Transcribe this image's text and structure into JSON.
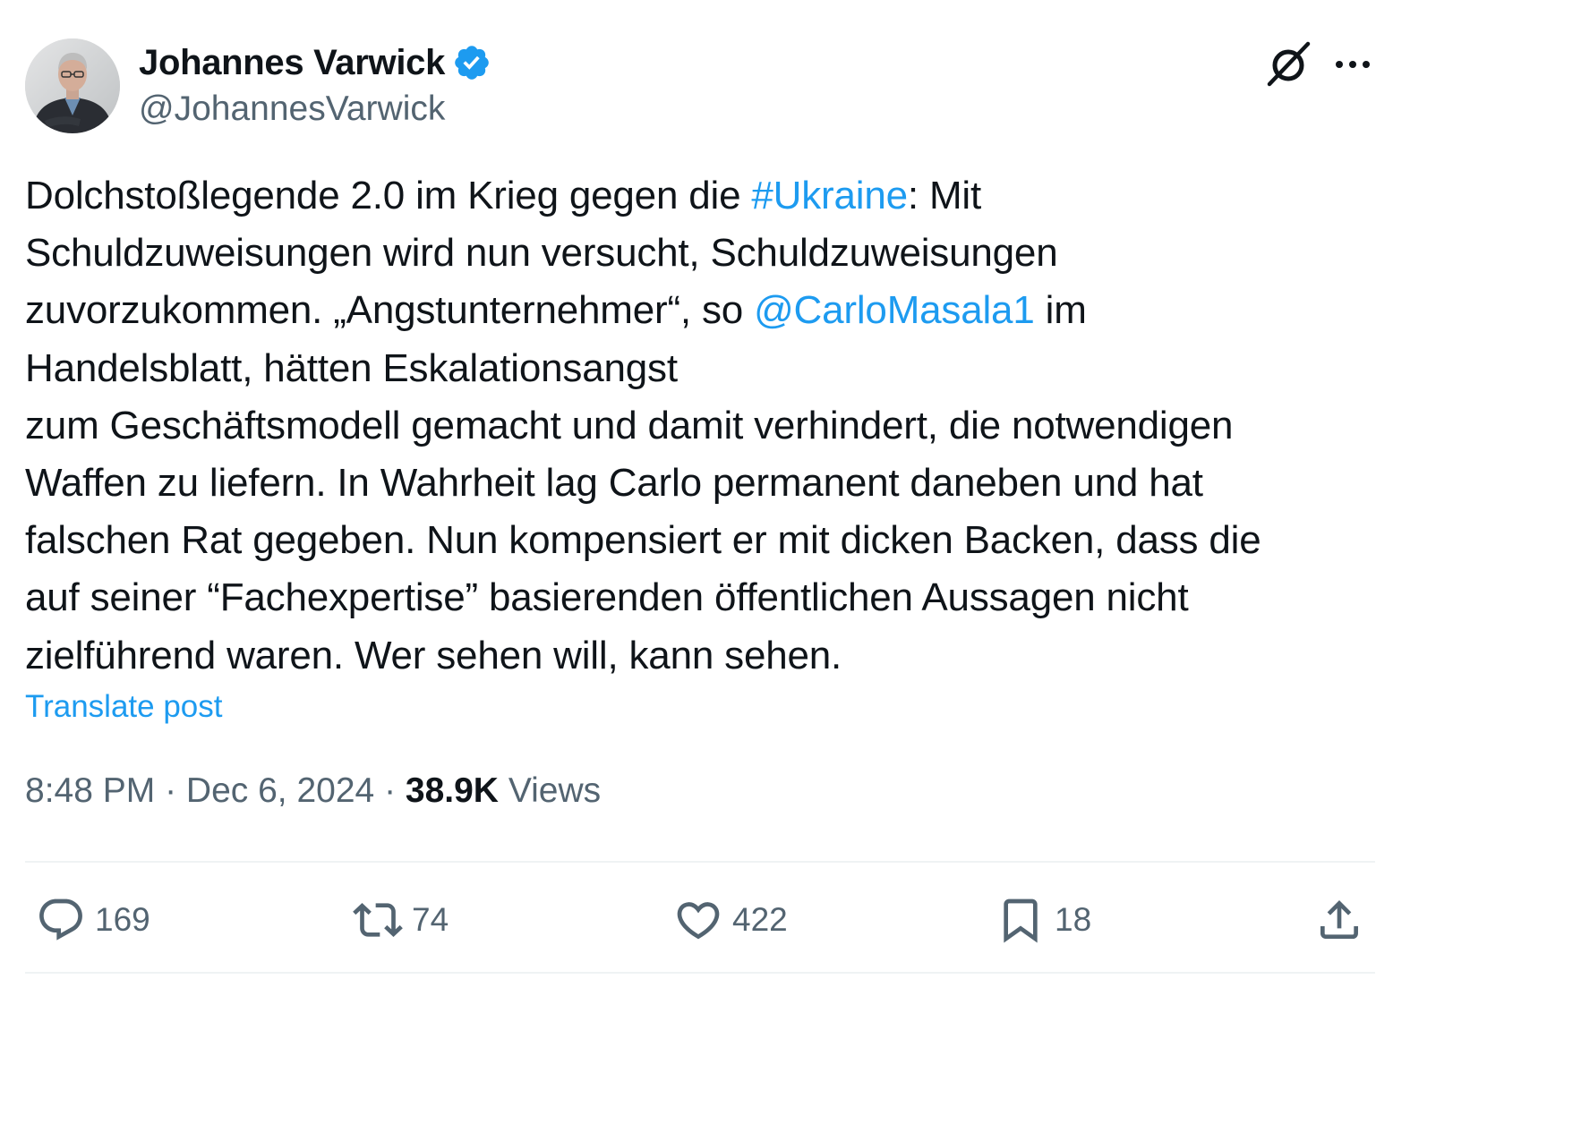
{
  "author": {
    "display_name": "Johannes Varwick",
    "handle": "@JohannesVarwick",
    "verified_icon": "verified-badge-icon",
    "avatar": "profile-photo"
  },
  "header_icons": {
    "grok": "grok-icon",
    "more": "more-options-icon"
  },
  "tweet": {
    "lines": [
      [
        "Dolchstoßlegende 2.0 im Krieg gegen die ",
        "#Ukraine",
        ": Mit"
      ],
      [
        "Schuldzuweisungen wird nun versucht, Schuldzuweisungen"
      ],
      [
        "zuvorzukommen. „Angstunternehmer“, so ",
        "@CarloMasala1",
        " im"
      ],
      [
        "Handelsblatt, hätten Eskalationsangst"
      ],
      [
        "zum Geschäftsmodell gemacht und damit verhindert, die notwendigen"
      ],
      [
        "Waffen zu liefern. In Wahrheit lag Carlo permanent daneben und hat"
      ],
      [
        "falschen Rat gegeben. Nun kompensiert er mit dicken Backen, dass die"
      ],
      [
        "auf seiner “Fachexpertise” basierenden öffentlichen Aussagen nicht"
      ],
      [
        "zielführend waren. Wer sehen will, kann sehen."
      ]
    ],
    "translate_label": "Translate post"
  },
  "meta": {
    "time": "8:48 PM",
    "separator": " · ",
    "date": "Dec 6, 2024",
    "views_count": "38.9K",
    "views_label": " Views"
  },
  "actions": {
    "replies": "169",
    "reposts": "74",
    "likes": "422",
    "bookmarks": "18"
  },
  "colors": {
    "link": "#1d9bf0",
    "secondary_text": "#536471",
    "primary_text": "#0f1419",
    "divider": "#eff3f4"
  }
}
